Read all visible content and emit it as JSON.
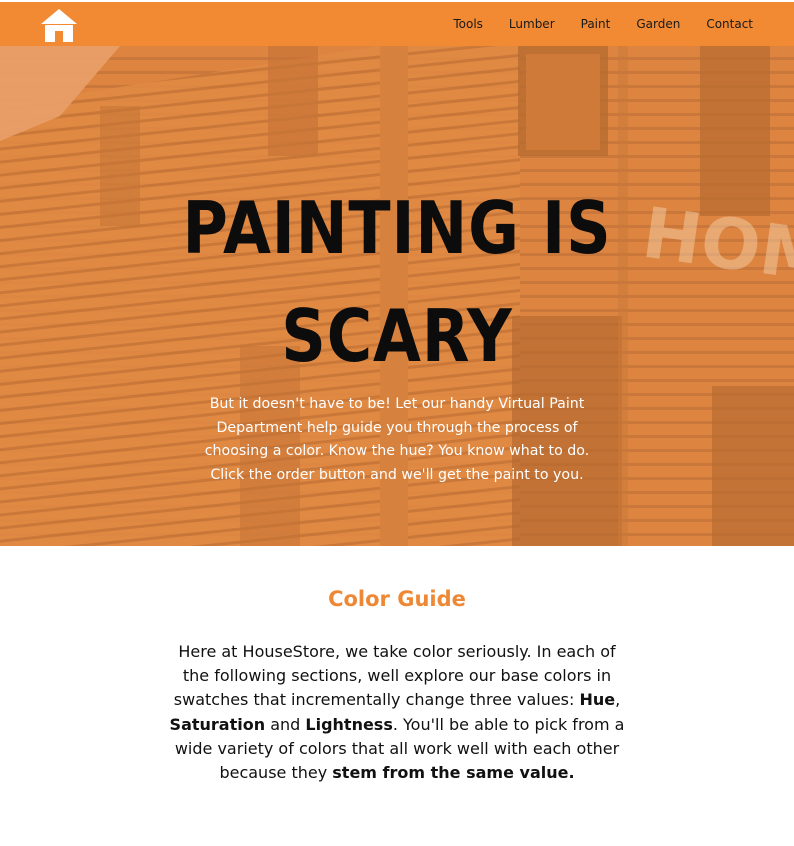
{
  "navbar": {
    "logo_icon": "house-icon",
    "links": [
      "Tools",
      "Lumber",
      "Paint",
      "Garden",
      "Contact"
    ],
    "background": "#f28a33"
  },
  "hero": {
    "title": "PAINTING IS SCARY",
    "text": "But it doesn't have to be! Let our handy Virtual Paint Department help guide you through the process of choosing a color. Know the hue? You know what to do. Click the order button and we'll get the paint to you.",
    "overlay_color": "#e28a42"
  },
  "color_guide": {
    "title": "Color Guide",
    "text_1": "Here at HouseStore, we take color seriously. In each of the following sections, well explore our base colors in swatches that incrementally change three values: ",
    "hue": "Hue",
    "sep_1": ", ",
    "saturation": "Saturation",
    "and": " and ",
    "lightness": "Lightness",
    "text_2": ". You'll be able to pick from a wide variety of colors that all work well with each other because they ",
    "emphasis": "stem from the same value.",
    "title_color": "#ee8834"
  }
}
